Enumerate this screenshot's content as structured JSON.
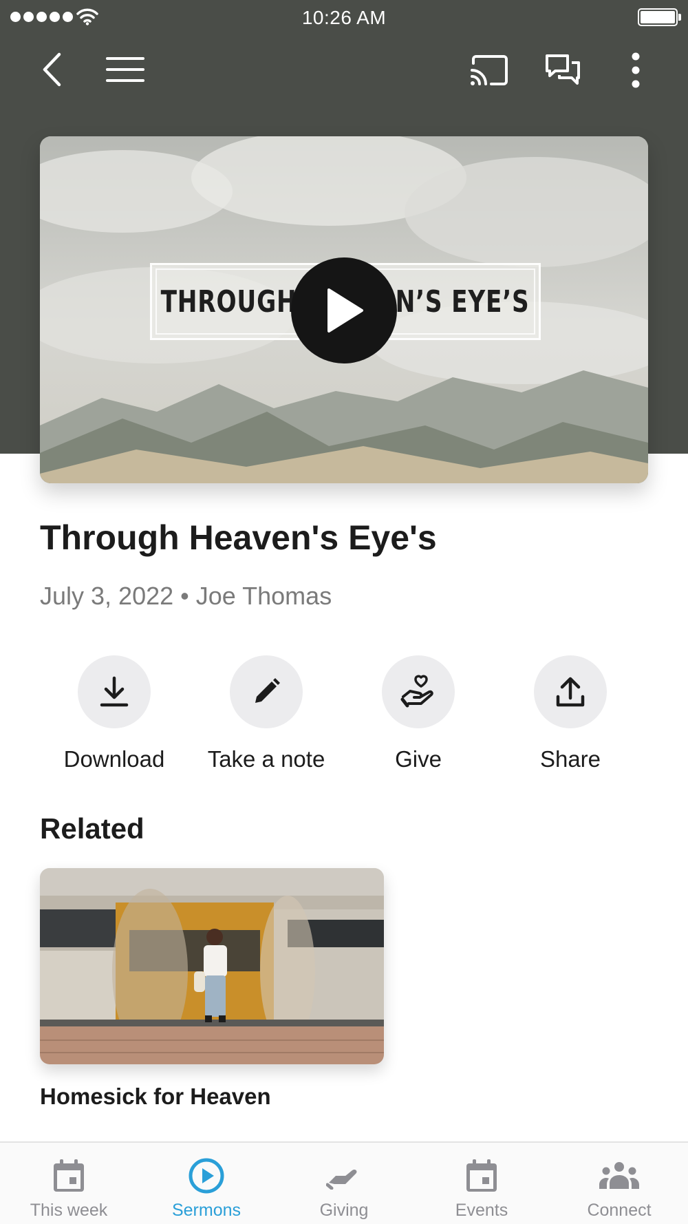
{
  "status_bar": {
    "time": "10:26 AM"
  },
  "header": {
    "back_icon": "chevron-left-icon",
    "menu_icon": "hamburger-menu-icon",
    "cast_icon": "cast-icon",
    "chat_icon": "chat-bubbles-icon",
    "more_icon": "more-vertical-icon"
  },
  "hero": {
    "artwork_title": "THROUGH HEAVEN’S EYE’S",
    "play_icon": "play-icon"
  },
  "sermon": {
    "title": "Through Heaven's Eye's",
    "date": "July 3, 2022",
    "separator": "•",
    "speaker": "Joe Thomas"
  },
  "actions": [
    {
      "label": "Download",
      "icon": "download-icon"
    },
    {
      "label": "Take a note",
      "icon": "pencil-icon"
    },
    {
      "label": "Give",
      "icon": "hand-heart-icon"
    },
    {
      "label": "Share",
      "icon": "share-icon"
    }
  ],
  "related": {
    "heading": "Related",
    "items": [
      {
        "title": "Homesick for Heaven"
      }
    ]
  },
  "tabbar": {
    "active": "Sermons",
    "active_color": "#2a9fd8",
    "inactive_color": "#8e8e93",
    "tabs": [
      {
        "label": "This week",
        "icon": "calendar-icon"
      },
      {
        "label": "Sermons",
        "icon": "play-circle-icon"
      },
      {
        "label": "Giving",
        "icon": "giving-hand-icon"
      },
      {
        "label": "Events",
        "icon": "calendar-icon"
      },
      {
        "label": "Connect",
        "icon": "group-icon"
      }
    ]
  },
  "colors": {
    "header_background": "#4a4d48",
    "action_circle": "#ececee",
    "meta_text": "#7a7a7a"
  }
}
